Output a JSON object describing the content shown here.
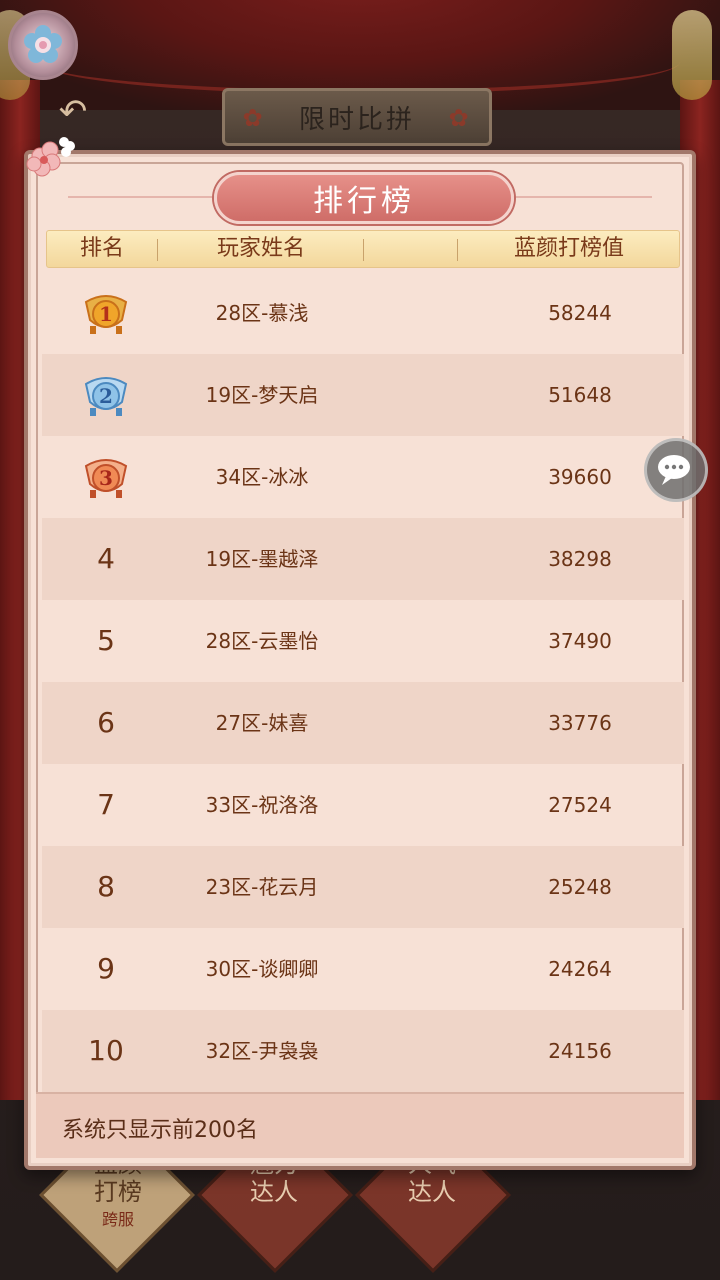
{
  "event": {
    "title": "限时比拼"
  },
  "panel": {
    "title": "排行榜",
    "columns": [
      "排名",
      "玩家姓名",
      "",
      "蓝颜打榜值"
    ],
    "footer_note": "系统只显示前200名"
  },
  "rankings": [
    {
      "rank": "1",
      "name": "28区-慕浅",
      "score": "58244",
      "medal": "gold"
    },
    {
      "rank": "2",
      "name": "19区-梦天启",
      "score": "51648",
      "medal": "silver"
    },
    {
      "rank": "3",
      "name": "34区-冰冰",
      "score": "39660",
      "medal": "bronze"
    },
    {
      "rank": "4",
      "name": "19区-墨越泽",
      "score": "38298"
    },
    {
      "rank": "5",
      "name": "28区-云墨怡",
      "score": "37490"
    },
    {
      "rank": "6",
      "name": "27区-妹喜",
      "score": "33776"
    },
    {
      "rank": "7",
      "name": "33区-祝洛洛",
      "score": "27524"
    },
    {
      "rank": "8",
      "name": "23区-花云月",
      "score": "25248"
    },
    {
      "rank": "9",
      "name": "30区-谈卿卿",
      "score": "24264"
    },
    {
      "rank": "10",
      "name": "32区-尹袅袅",
      "score": "24156"
    }
  ],
  "bottom_tabs": [
    {
      "label_line1": "蓝颜",
      "label_line2": "打榜",
      "sub": "跨服",
      "active": true
    },
    {
      "label_line1": "魅力",
      "label_line2": "达人",
      "active": false
    },
    {
      "label_line1": "人气",
      "label_line2": "达人",
      "active": false
    }
  ],
  "colors": {
    "panel_bg": "#f7e1d6",
    "row_alt": "#efd5c8",
    "text": "#6b3416",
    "title_bg": "#d97a73",
    "header_bg": "#f6dfa8"
  },
  "icons": {
    "settings": "flower-settings-icon",
    "back": "back-arrow-icon",
    "chat": "chat-bubble-icon",
    "medals": [
      "gold-medal-icon",
      "silver-medal-icon",
      "bronze-medal-icon"
    ]
  }
}
